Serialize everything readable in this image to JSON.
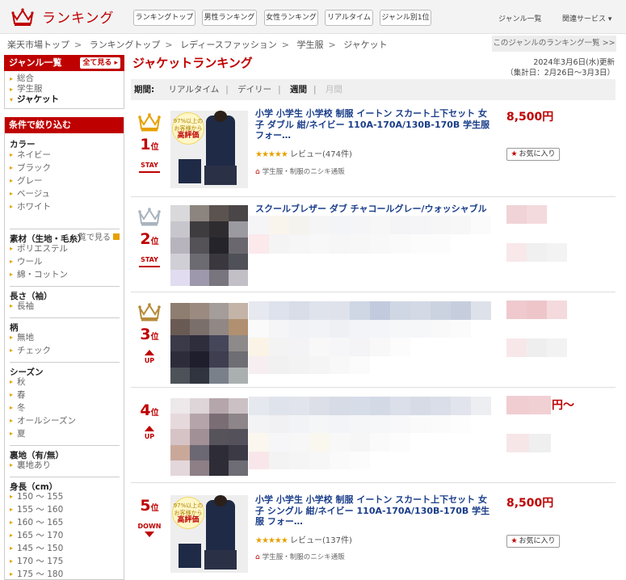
{
  "header": {
    "logo_text": "ランキング",
    "nav": [
      "ランキングトップ",
      "男性ランキング",
      "女性ランキング",
      "リアルタイム",
      "ジャンル別1位"
    ],
    "genre_list": "ジャンル一覧",
    "related": "関連サービス"
  },
  "breadcrumb": [
    "楽天市場トップ",
    "ランキングトップ",
    "レディースファッション",
    "学生服",
    "ジャケット"
  ],
  "genre_rank_link": "このジャンルのランキング一覧 >>",
  "sidebar": {
    "genre_head": "ジャンル一覧",
    "all_view": "全て見る",
    "genre_items": [
      "総合",
      "学生服",
      "ジャケット"
    ],
    "filter_head": "条件で絞り込む",
    "sections": [
      {
        "title": "カラー",
        "items": [
          "ネイビー",
          "ブラック",
          "グレー",
          "ベージュ",
          "ホワイト"
        ],
        "more": "一覧で見る"
      },
      {
        "title": "素材（生地・毛糸）",
        "items": [
          "ポリエステル",
          "ウール",
          "綿・コットン"
        ]
      },
      {
        "title": "長さ（袖）",
        "items": [
          "長袖"
        ]
      },
      {
        "title": "柄",
        "items": [
          "無地",
          "チェック"
        ]
      },
      {
        "title": "シーズン",
        "items": [
          "秋",
          "春",
          "冬",
          "オールシーズン",
          "夏"
        ]
      },
      {
        "title": "裏地（有/無）",
        "items": [
          "裏地あり"
        ]
      },
      {
        "title": "身長（cm）",
        "items": [
          "150 〜 155",
          "155 〜 160",
          "160 〜 165",
          "165 〜 170",
          "145 〜 150",
          "170 〜 175",
          "175 〜 180"
        ]
      }
    ]
  },
  "main": {
    "title": "ジャケットランキング",
    "updated": "2024年3月6日(水)更新",
    "period_range": "（集計日：2月26日〜3月3日）",
    "period_label": "期間:",
    "periods": [
      "リアルタイム",
      "デイリー",
      "週間",
      "月間"
    ]
  },
  "items": [
    {
      "rank": "1",
      "rank_suffix": "位",
      "status": "STAY",
      "title": "小学 小学生 小学校 制服 イートン スカート上下セット 女子 ダブル 紺/ネイビー 110A-170A/130B-170B 学生服 フォー…",
      "stars": "★★★★★",
      "review": "レビュー(474件)",
      "shop": "学生服・制服のニシキ通販",
      "price": "8,500円",
      "fav": "お気に入り",
      "badge_a": "97%以上の",
      "badge_b": "お客様から",
      "badge_c": "高評価"
    },
    {
      "rank": "2",
      "rank_suffix": "位",
      "status": "STAY",
      "title": "スクールブレザー ダブ チャコールグレー/ウォッシャブル 撥"
    },
    {
      "rank": "3",
      "rank_suffix": "位",
      "status": "UP"
    },
    {
      "rank": "4",
      "rank_suffix": "位",
      "status": "UP",
      "price_tail": "円〜"
    },
    {
      "rank": "5",
      "rank_suffix": "位",
      "status": "DOWN",
      "title": "小学 小学生 小学校 制服 イートン スカート上下セット 女子 シングル 紺/ネイビー 110A-170A/130B-170B 学生服 フォー…",
      "stars": "★★★★★",
      "review": "レビュー(137件)",
      "shop": "学生服・制服のニシキ通販",
      "price": "8,500円",
      "fav": "お気に入り",
      "badge_a": "97%以上の",
      "badge_b": "お客様から",
      "badge_c": "高評価"
    }
  ],
  "colors": {
    "brand": "#bf0000",
    "gold": "#e6a100",
    "silver": "#a9b4bf",
    "link": "#1a3e8a"
  }
}
